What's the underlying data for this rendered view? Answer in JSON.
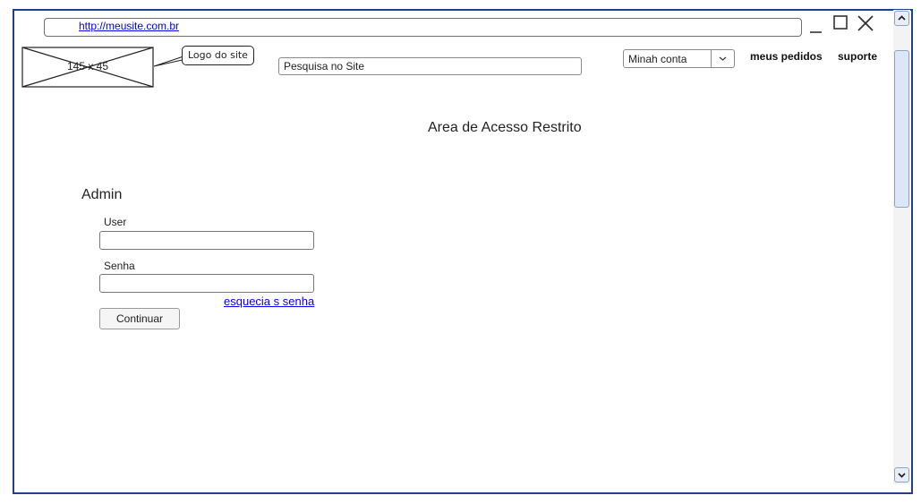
{
  "browser": {
    "url": "http://meusite.com.br"
  },
  "header": {
    "logo_size": "145 x 45",
    "logo_note": "Logo do site",
    "search_placeholder": "Pesquisa no Site",
    "account_select": "Minah conta",
    "nav_orders": "meus pedidos",
    "nav_support": "suporte"
  },
  "main": {
    "title": "Area de Acesso Restrito",
    "section_title": "Admin",
    "user_label": "User",
    "user_value": "",
    "senha_label": "Senha",
    "senha_value": "",
    "forgot_link": "esquecia s senha",
    "continue_button": "Continuar"
  },
  "icons": {
    "minimize": "minimize-icon",
    "maximize": "maximize-icon",
    "close": "close-icon",
    "scroll_up": "chevron-up-icon",
    "scroll_down": "chevron-down-icon",
    "select_arrow": "chevron-down-icon"
  },
  "colors": {
    "frame": "#1f3f8f",
    "link": "#0000ee",
    "scrollbar": "#dbe7f6"
  }
}
